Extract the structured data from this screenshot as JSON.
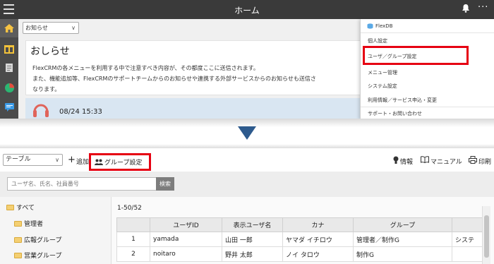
{
  "top": {
    "app_title": "ホーム",
    "notice_select": "お知らせ",
    "notice_heading": "おしらせ",
    "notice_lines": [
      "FlexCRMの各メニューを利用する中で注意すべき内容が、その都度ここに送信されます。",
      "また、機能追加等、FlexCRMのサポートチームからのお知らせや連携する外部サービスからのお知らせも送信さ",
      "なります。"
    ],
    "notice_time": "08/24 15:33",
    "menu": {
      "header": "FlexDB",
      "items": [
        "個人設定",
        "ユーザ／グループ設定",
        "メニュー管理",
        "システム設定",
        "利用情報／サービス申込・変更",
        "サポート・お問い合わせ"
      ]
    }
  },
  "bottom": {
    "view_select": "テーブル",
    "add_label": "追加",
    "group_settings_label": "グループ設定",
    "info_label": "情報",
    "manual_label": "マニュアル",
    "print_label": "印刷",
    "search_placeholder": "ユーザ名、氏名、社員番号",
    "search_button": "検索",
    "tree": [
      "すべて",
      "管理者",
      "広報グループ",
      "営業グループ"
    ],
    "count_text": "1-50/52",
    "table": {
      "headers": [
        "",
        "ユーザID",
        "表示ユーザ名",
        "カナ",
        "グループ",
        ""
      ],
      "rows": [
        [
          "1",
          "yamada",
          "山田 一郎",
          "ヤマダ イチロウ",
          "管理者／制作G",
          "システ"
        ],
        [
          "2",
          "noitaro",
          "野井 太郎",
          "ノイ タロウ",
          "制作G",
          ""
        ]
      ]
    }
  },
  "colors": {
    "highlight": "#e60012",
    "arrow": "#2d5a8d",
    "topbar": "#3a3a3a"
  }
}
